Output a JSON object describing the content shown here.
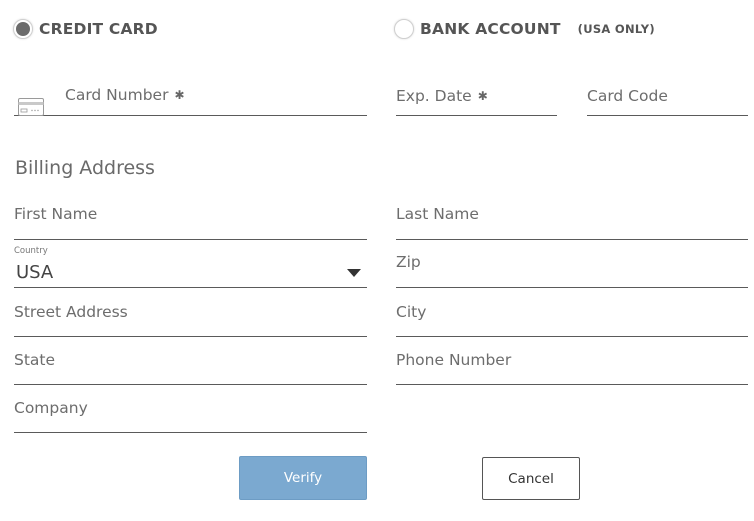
{
  "payment_type": {
    "credit_card_label": "CREDIT CARD",
    "bank_account_label": "BANK ACCOUNT",
    "bank_account_note": "(USA ONLY)",
    "selected": "credit_card"
  },
  "card": {
    "card_number_placeholder": "Card Number",
    "exp_date_placeholder": "Exp. Date",
    "card_code_placeholder": "Card Code",
    "required_marker": "✱",
    "card_icon": "credit-card-icon"
  },
  "billing": {
    "title": "Billing Address",
    "first_name_placeholder": "First Name",
    "last_name_placeholder": "Last Name",
    "country_label": "Country",
    "country_value": "USA",
    "zip_placeholder": "Zip",
    "street_placeholder": "Street Address",
    "city_placeholder": "City",
    "state_placeholder": "State",
    "phone_placeholder": "Phone Number",
    "company_placeholder": "Company"
  },
  "actions": {
    "verify_label": "Verify",
    "cancel_label": "Cancel"
  },
  "colors": {
    "verify_bg": "#7ba9d0",
    "underline": "#5a5a5a",
    "text": "#555555"
  }
}
